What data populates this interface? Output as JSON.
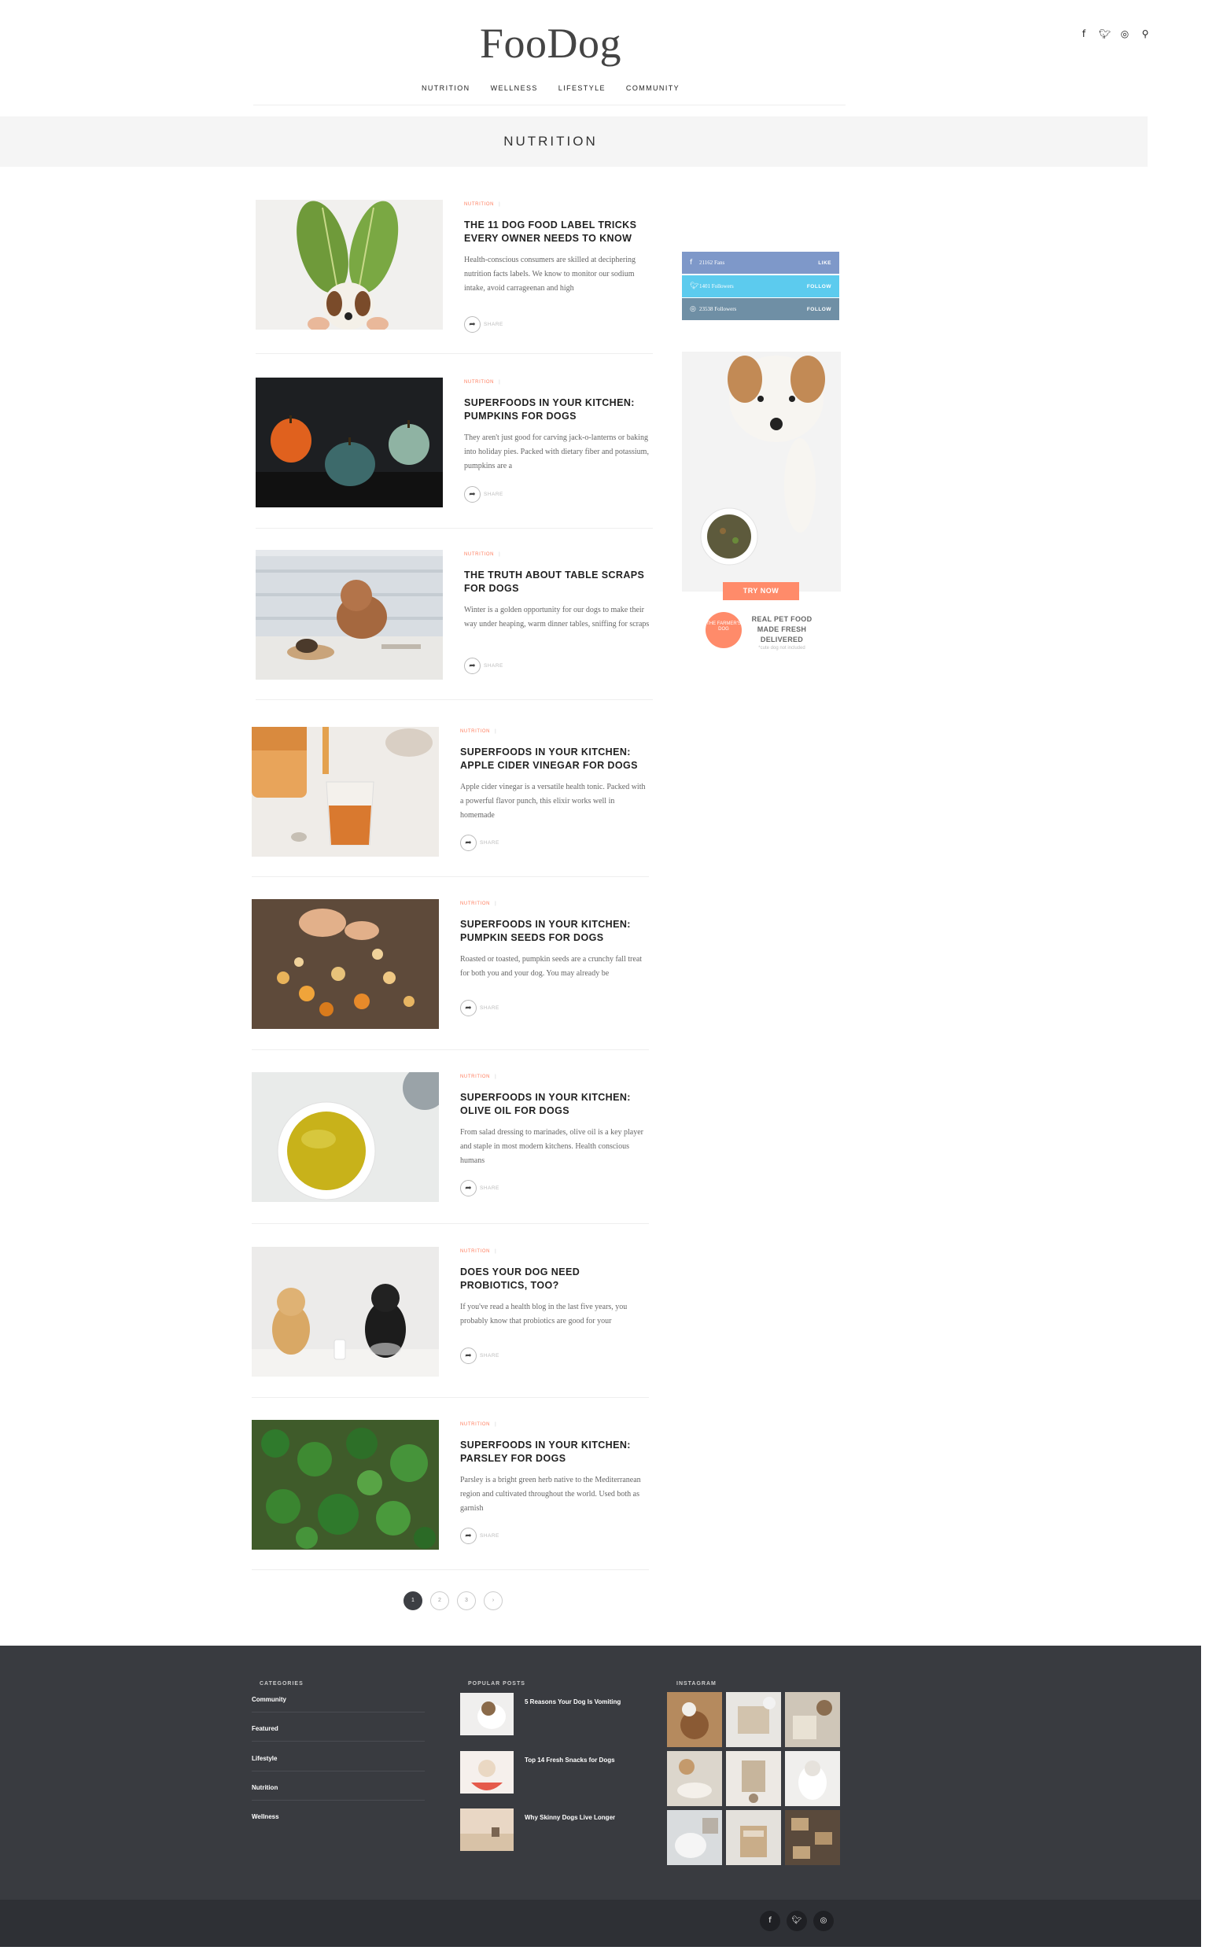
{
  "site": {
    "logo": "FooDog",
    "social_icons": [
      "facebook-icon",
      "twitter-icon",
      "instagram-icon",
      "search-icon"
    ],
    "nav": [
      "NUTRITION",
      "WELLNESS",
      "LIFESTYLE",
      "COMMUNITY"
    ],
    "category_title": "NUTRITION"
  },
  "posts": [
    {
      "category": "NUTRITION",
      "title": "THE 11 DOG FOOD LABEL TRICKS EVERY OWNER NEEDS TO KNOW",
      "excerpt": "Health-conscious consumers are skilled at deciphering nutrition facts labels. We know to monitor our sodium intake, avoid carrageenan and high",
      "share": "SHARE"
    },
    {
      "category": "NUTRITION",
      "title": "SUPERFOODS IN YOUR KITCHEN: PUMPKINS FOR DOGS",
      "excerpt": "They aren't just good for carving jack-o-lanterns or baking into holiday pies. Packed with dietary fiber and potassium, pumpkins are a",
      "share": "SHARE"
    },
    {
      "category": "NUTRITION",
      "title": "THE TRUTH ABOUT TABLE SCRAPS FOR DOGS",
      "excerpt": "Winter is a golden opportunity for our dogs to make their way under heaping, warm dinner tables, sniffing for scraps",
      "share": "SHARE"
    },
    {
      "category": "NUTRITION",
      "title": "SUPERFOODS IN YOUR KITCHEN: APPLE CIDER VINEGAR FOR DOGS",
      "excerpt": "Apple cider vinegar is a versatile health tonic. Packed with a powerful flavor punch, this elixir works well in homemade",
      "share": "SHARE"
    },
    {
      "category": "NUTRITION",
      "title": "SUPERFOODS IN YOUR KITCHEN: PUMPKIN SEEDS FOR DOGS",
      "excerpt": "Roasted or toasted, pumpkin seeds are a crunchy fall treat for both you and your dog. You may already be",
      "share": "SHARE"
    },
    {
      "category": "NUTRITION",
      "title": "SUPERFOODS IN YOUR KITCHEN: OLIVE OIL FOR DOGS",
      "excerpt": "From salad dressing to marinades, olive oil is a key player and staple in most modern kitchens. Health conscious humans",
      "share": "SHARE"
    },
    {
      "category": "NUTRITION",
      "title": "DOES YOUR DOG NEED PROBIOTICS, TOO?",
      "excerpt": "If you've read a health blog in the last five years, you probably know that probiotics are good for your",
      "share": "SHARE"
    },
    {
      "category": "NUTRITION",
      "title": "SUPERFOODS IN YOUR KITCHEN: PARSLEY FOR DOGS",
      "excerpt": "Parsley is a bright green herb native to the Mediterranean region and cultivated throughout the world. Used both as garnish",
      "share": "SHARE"
    }
  ],
  "sidebar": {
    "social": [
      {
        "icon": "facebook-icon",
        "count": "21162 Fans",
        "action": "LIKE",
        "color": "#7e98c9"
      },
      {
        "icon": "twitter-icon",
        "count": "1401 Followers",
        "action": "FOLLOW",
        "color": "#5ccbee"
      },
      {
        "icon": "instagram-icon",
        "count": "23538 Followers",
        "action": "FOLLOW",
        "color": "#6f8fa5"
      }
    ],
    "ad": {
      "button": "TRY NOW",
      "badge": "THE FARMER'S DOG",
      "tagline": "REAL PET FOOD MADE FRESH DELIVERED",
      "fine_print": "*cute dog not included"
    }
  },
  "pagination": [
    "1",
    "2",
    "3",
    "›"
  ],
  "footer": {
    "categories_heading": "CATEGORIES",
    "categories": [
      "Community",
      "Featured",
      "Lifestyle",
      "Nutrition",
      "Wellness"
    ],
    "popular_heading": "POPULAR POSTS",
    "popular": [
      "5 Reasons Your Dog Is Vomiting",
      "Top 14 Fresh Snacks for Dogs",
      "Why Skinny Dogs Live Longer"
    ],
    "instagram_heading": "INSTAGRAM",
    "bottom_social": [
      "facebook-icon",
      "twitter-icon",
      "instagram-icon"
    ]
  },
  "colors": {
    "accent": "#ff7e5f",
    "footer_bg": "#393b40",
    "bottom_bar": "#2e3035",
    "band_bg": "#f5f5f5"
  }
}
